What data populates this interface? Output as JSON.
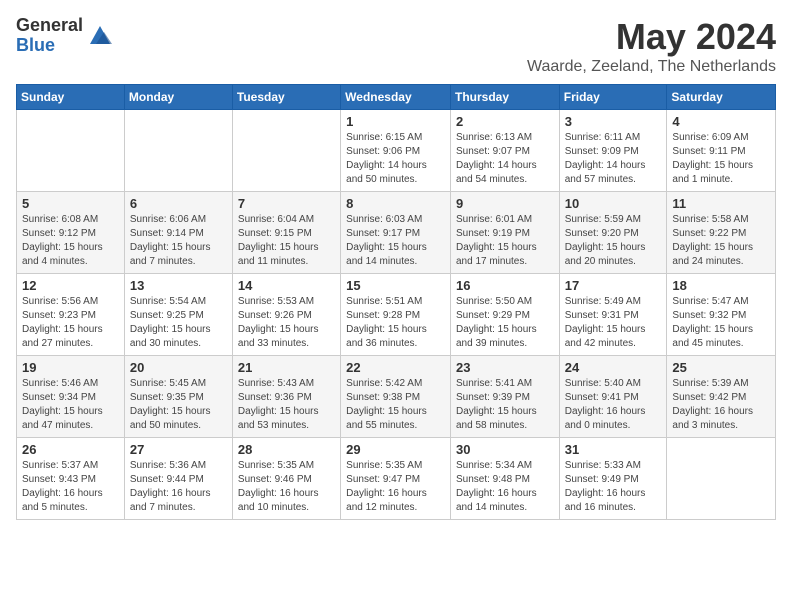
{
  "logo": {
    "general": "General",
    "blue": "Blue"
  },
  "title": {
    "month": "May 2024",
    "location": "Waarde, Zeeland, The Netherlands"
  },
  "weekdays": [
    "Sunday",
    "Monday",
    "Tuesday",
    "Wednesday",
    "Thursday",
    "Friday",
    "Saturday"
  ],
  "weeks": [
    [
      {
        "day": "",
        "sunrise": "",
        "sunset": "",
        "daylight": ""
      },
      {
        "day": "",
        "sunrise": "",
        "sunset": "",
        "daylight": ""
      },
      {
        "day": "",
        "sunrise": "",
        "sunset": "",
        "daylight": ""
      },
      {
        "day": "1",
        "sunrise": "Sunrise: 6:15 AM",
        "sunset": "Sunset: 9:06 PM",
        "daylight": "Daylight: 14 hours and 50 minutes."
      },
      {
        "day": "2",
        "sunrise": "Sunrise: 6:13 AM",
        "sunset": "Sunset: 9:07 PM",
        "daylight": "Daylight: 14 hours and 54 minutes."
      },
      {
        "day": "3",
        "sunrise": "Sunrise: 6:11 AM",
        "sunset": "Sunset: 9:09 PM",
        "daylight": "Daylight: 14 hours and 57 minutes."
      },
      {
        "day": "4",
        "sunrise": "Sunrise: 6:09 AM",
        "sunset": "Sunset: 9:11 PM",
        "daylight": "Daylight: 15 hours and 1 minute."
      }
    ],
    [
      {
        "day": "5",
        "sunrise": "Sunrise: 6:08 AM",
        "sunset": "Sunset: 9:12 PM",
        "daylight": "Daylight: 15 hours and 4 minutes."
      },
      {
        "day": "6",
        "sunrise": "Sunrise: 6:06 AM",
        "sunset": "Sunset: 9:14 PM",
        "daylight": "Daylight: 15 hours and 7 minutes."
      },
      {
        "day": "7",
        "sunrise": "Sunrise: 6:04 AM",
        "sunset": "Sunset: 9:15 PM",
        "daylight": "Daylight: 15 hours and 11 minutes."
      },
      {
        "day": "8",
        "sunrise": "Sunrise: 6:03 AM",
        "sunset": "Sunset: 9:17 PM",
        "daylight": "Daylight: 15 hours and 14 minutes."
      },
      {
        "day": "9",
        "sunrise": "Sunrise: 6:01 AM",
        "sunset": "Sunset: 9:19 PM",
        "daylight": "Daylight: 15 hours and 17 minutes."
      },
      {
        "day": "10",
        "sunrise": "Sunrise: 5:59 AM",
        "sunset": "Sunset: 9:20 PM",
        "daylight": "Daylight: 15 hours and 20 minutes."
      },
      {
        "day": "11",
        "sunrise": "Sunrise: 5:58 AM",
        "sunset": "Sunset: 9:22 PM",
        "daylight": "Daylight: 15 hours and 24 minutes."
      }
    ],
    [
      {
        "day": "12",
        "sunrise": "Sunrise: 5:56 AM",
        "sunset": "Sunset: 9:23 PM",
        "daylight": "Daylight: 15 hours and 27 minutes."
      },
      {
        "day": "13",
        "sunrise": "Sunrise: 5:54 AM",
        "sunset": "Sunset: 9:25 PM",
        "daylight": "Daylight: 15 hours and 30 minutes."
      },
      {
        "day": "14",
        "sunrise": "Sunrise: 5:53 AM",
        "sunset": "Sunset: 9:26 PM",
        "daylight": "Daylight: 15 hours and 33 minutes."
      },
      {
        "day": "15",
        "sunrise": "Sunrise: 5:51 AM",
        "sunset": "Sunset: 9:28 PM",
        "daylight": "Daylight: 15 hours and 36 minutes."
      },
      {
        "day": "16",
        "sunrise": "Sunrise: 5:50 AM",
        "sunset": "Sunset: 9:29 PM",
        "daylight": "Daylight: 15 hours and 39 minutes."
      },
      {
        "day": "17",
        "sunrise": "Sunrise: 5:49 AM",
        "sunset": "Sunset: 9:31 PM",
        "daylight": "Daylight: 15 hours and 42 minutes."
      },
      {
        "day": "18",
        "sunrise": "Sunrise: 5:47 AM",
        "sunset": "Sunset: 9:32 PM",
        "daylight": "Daylight: 15 hours and 45 minutes."
      }
    ],
    [
      {
        "day": "19",
        "sunrise": "Sunrise: 5:46 AM",
        "sunset": "Sunset: 9:34 PM",
        "daylight": "Daylight: 15 hours and 47 minutes."
      },
      {
        "day": "20",
        "sunrise": "Sunrise: 5:45 AM",
        "sunset": "Sunset: 9:35 PM",
        "daylight": "Daylight: 15 hours and 50 minutes."
      },
      {
        "day": "21",
        "sunrise": "Sunrise: 5:43 AM",
        "sunset": "Sunset: 9:36 PM",
        "daylight": "Daylight: 15 hours and 53 minutes."
      },
      {
        "day": "22",
        "sunrise": "Sunrise: 5:42 AM",
        "sunset": "Sunset: 9:38 PM",
        "daylight": "Daylight: 15 hours and 55 minutes."
      },
      {
        "day": "23",
        "sunrise": "Sunrise: 5:41 AM",
        "sunset": "Sunset: 9:39 PM",
        "daylight": "Daylight: 15 hours and 58 minutes."
      },
      {
        "day": "24",
        "sunrise": "Sunrise: 5:40 AM",
        "sunset": "Sunset: 9:41 PM",
        "daylight": "Daylight: 16 hours and 0 minutes."
      },
      {
        "day": "25",
        "sunrise": "Sunrise: 5:39 AM",
        "sunset": "Sunset: 9:42 PM",
        "daylight": "Daylight: 16 hours and 3 minutes."
      }
    ],
    [
      {
        "day": "26",
        "sunrise": "Sunrise: 5:37 AM",
        "sunset": "Sunset: 9:43 PM",
        "daylight": "Daylight: 16 hours and 5 minutes."
      },
      {
        "day": "27",
        "sunrise": "Sunrise: 5:36 AM",
        "sunset": "Sunset: 9:44 PM",
        "daylight": "Daylight: 16 hours and 7 minutes."
      },
      {
        "day": "28",
        "sunrise": "Sunrise: 5:35 AM",
        "sunset": "Sunset: 9:46 PM",
        "daylight": "Daylight: 16 hours and 10 minutes."
      },
      {
        "day": "29",
        "sunrise": "Sunrise: 5:35 AM",
        "sunset": "Sunset: 9:47 PM",
        "daylight": "Daylight: 16 hours and 12 minutes."
      },
      {
        "day": "30",
        "sunrise": "Sunrise: 5:34 AM",
        "sunset": "Sunset: 9:48 PM",
        "daylight": "Daylight: 16 hours and 14 minutes."
      },
      {
        "day": "31",
        "sunrise": "Sunrise: 5:33 AM",
        "sunset": "Sunset: 9:49 PM",
        "daylight": "Daylight: 16 hours and 16 minutes."
      },
      {
        "day": "",
        "sunrise": "",
        "sunset": "",
        "daylight": ""
      }
    ]
  ]
}
